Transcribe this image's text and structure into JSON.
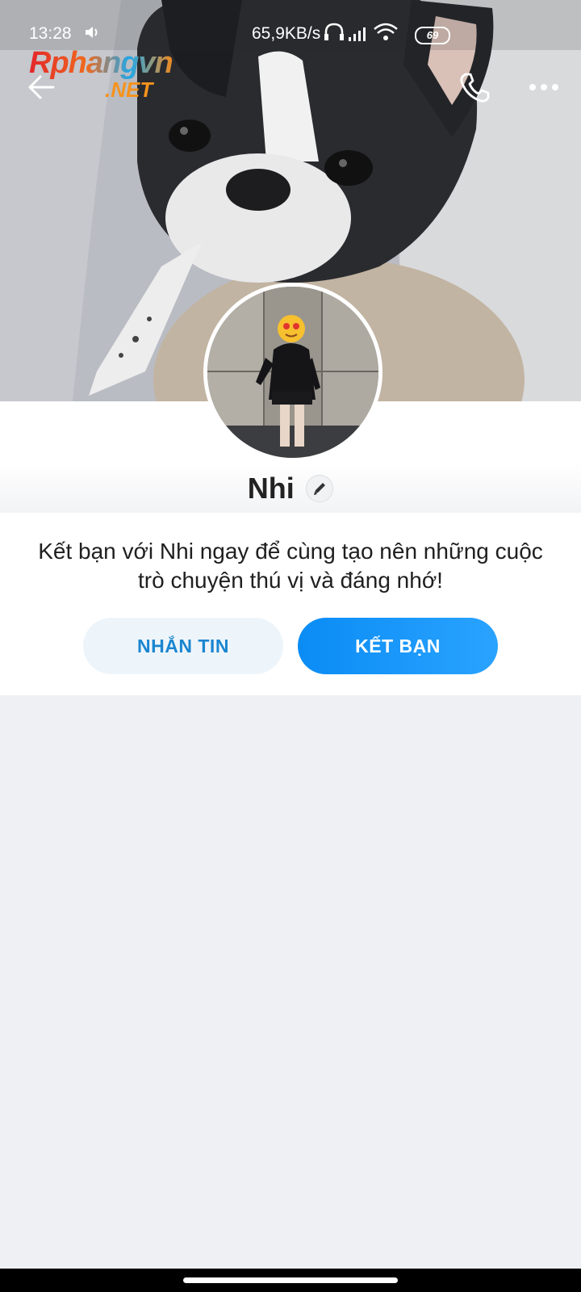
{
  "status_bar": {
    "time": "13:28",
    "network_speed": "65,9KB/s",
    "battery": "69"
  },
  "watermark": {
    "line1": "Rphangvn",
    "line2": ".NET"
  },
  "header": {
    "back_icon": "arrow-left-icon",
    "call_icon": "phone-icon",
    "more_icon": "more-horizontal-icon"
  },
  "profile": {
    "name": "Nhi",
    "edit_icon": "pencil-icon"
  },
  "invite": {
    "message": "Kết bạn với Nhi ngay để cùng tạo nên những cuộc trò chuyện thú vị và đáng nhớ!",
    "message_button": "NHẮN TIN",
    "add_friend_button": "KẾT BẠN"
  },
  "colors": {
    "primary": "#0a8cf5",
    "secondary_btn_bg": "#eef5fa",
    "secondary_btn_text": "#1b86d0",
    "page_bg": "#eef0f4"
  }
}
